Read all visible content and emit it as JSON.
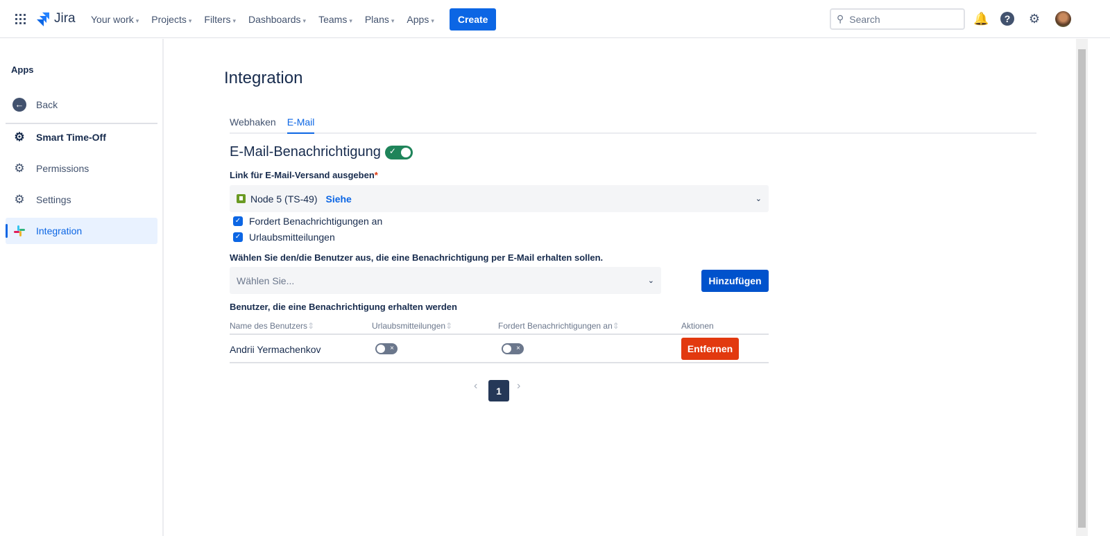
{
  "topbar": {
    "product": "Jira",
    "nav": [
      "Your work",
      "Projects",
      "Filters",
      "Dashboards",
      "Teams",
      "Plans",
      "Apps"
    ],
    "create": "Create",
    "search_placeholder": "Search"
  },
  "sidebar": {
    "title": "Apps",
    "back": "Back",
    "items": [
      {
        "label": "Smart Time-Off",
        "icon": "gear-person-icon"
      },
      {
        "label": "Permissions",
        "icon": "gear-person-icon"
      },
      {
        "label": "Settings",
        "icon": "gear-person-icon"
      },
      {
        "label": "Integration",
        "icon": "slack-icon",
        "active": true
      }
    ]
  },
  "main": {
    "title": "Integration",
    "tabs": [
      "Webhaken",
      "E-Mail"
    ],
    "active_tab": "E-Mail",
    "section_title": "E-Mail-Benachrichtigung",
    "section_enabled": true,
    "link_label": "Link für E-Mail-Versand ausgeben",
    "required": "*",
    "link_value": "Node 5 (TS-49)",
    "link_action": "Siehe",
    "checkboxes": [
      {
        "label": "Fordert Benachrichtigungen an",
        "checked": true
      },
      {
        "label": "Urlaubsmitteilungen",
        "checked": true
      }
    ],
    "user_select_label": "Wählen Sie den/die Benutzer aus, die eine Benachrichtigung per E-Mail erhalten sollen.",
    "user_select_placeholder": "Wählen Sie...",
    "add_button": "Hinzufügen",
    "table_title": "Benutzer, die eine Benachrichtigung erhalten werden",
    "columns": [
      "Name des Benutzers",
      "Urlaubsmitteilungen",
      "Fordert Benachrichtigungen an",
      "Aktionen"
    ],
    "rows": [
      {
        "name": "Andrii Yermachenkov",
        "vacation": false,
        "requests": false,
        "action": "Entfernen"
      }
    ],
    "pagination": {
      "current": "1"
    }
  },
  "colors": {
    "primary": "#0c66e4",
    "success": "#1f845a",
    "danger": "#e2390f",
    "page_active": "#253858"
  }
}
